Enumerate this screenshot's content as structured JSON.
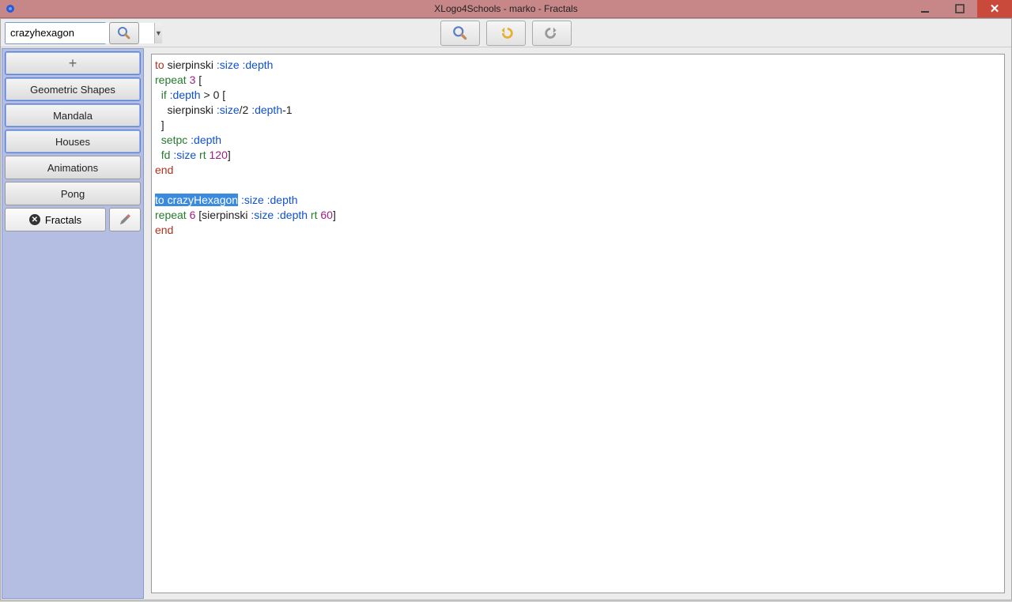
{
  "titlebar": {
    "title": "XLogo4Schools - marko - Fractals"
  },
  "toolbar": {
    "combo_value": "crazyhexagon"
  },
  "sidebar": {
    "items": [
      {
        "label": "Geometric Shapes"
      },
      {
        "label": "Mandala"
      },
      {
        "label": "Houses"
      },
      {
        "label": "Animations"
      },
      {
        "label": "Pong"
      }
    ],
    "active": {
      "label": "Fractals"
    }
  },
  "code": {
    "l1_to": "to",
    "l1_name": " sierpinski ",
    "l1_args": ":size :depth",
    "l2_repeat": "repeat",
    "l2_num": " 3 ",
    "l2_br": "[",
    "l3_if": "  if ",
    "l3_arg": ":depth",
    "l3_gt": " > 0 ",
    "l3_br": "[",
    "l4_call": "    sierpinski ",
    "l4_a1": ":size",
    "l4_slash": "/2 ",
    "l4_a2": ":depth",
    "l4_m1": "-1",
    "l5_br": "  ]",
    "l6_setpc": "  setpc ",
    "l6_a": ":depth",
    "l7_fd": "  fd ",
    "l7_a": ":size",
    "l7_rt": " rt ",
    "l7_n": "120",
    "l7_br": "]",
    "l8_end": "end",
    "blank": "",
    "l9_sel": "to crazyHexagon",
    "l9_args": " :size :depth",
    "l10_repeat": "repeat",
    "l10_n": " 6 ",
    "l10_b1": "[",
    "l10_call": "sierpinski ",
    "l10_a1": ":size ",
    "l10_a2": ":depth",
    "l10_rt": " rt ",
    "l10_rtn": "60",
    "l10_b2": "]",
    "l11_end": "end"
  }
}
